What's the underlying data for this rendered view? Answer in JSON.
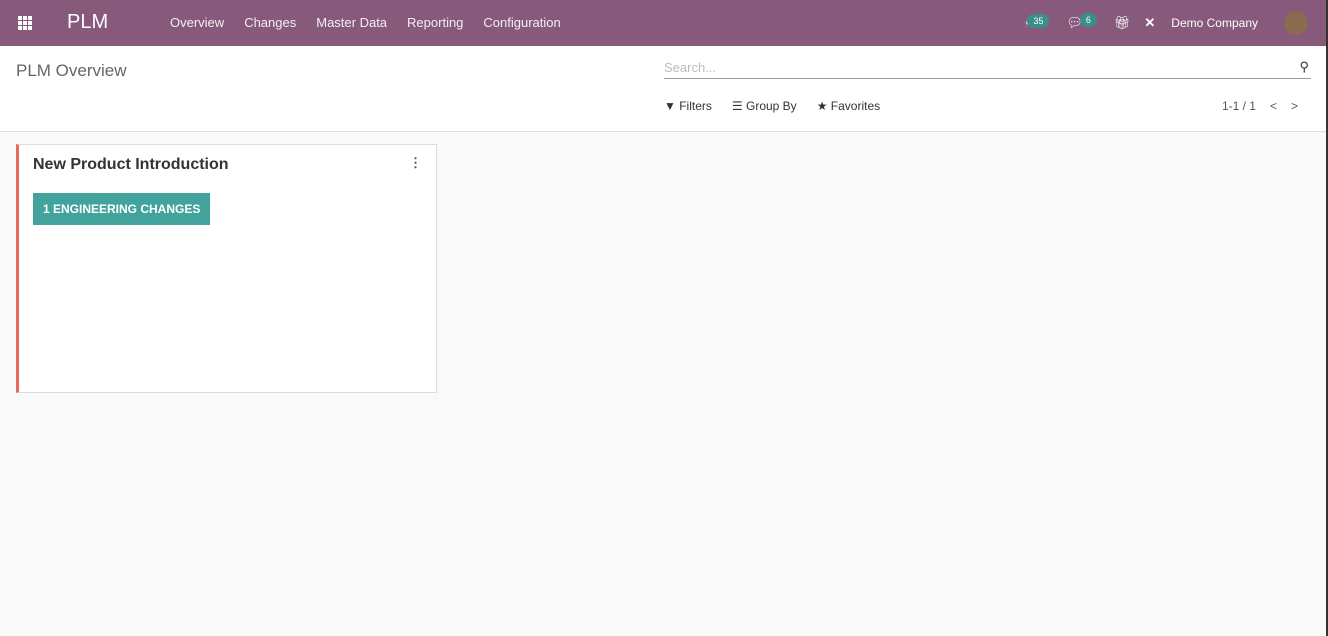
{
  "nav": {
    "brand": "PLM",
    "menu": [
      "Overview",
      "Changes",
      "Master Data",
      "Reporting",
      "Configuration"
    ],
    "activities_count": "35",
    "messages_count": "6",
    "company": "Demo Company"
  },
  "control": {
    "title": "PLM Overview",
    "search_placeholder": "Search...",
    "filters": "Filters",
    "group_by": "Group By",
    "favorites": "Favorites",
    "pager": "1-1 / 1"
  },
  "cards": [
    {
      "title": "New Product Introduction",
      "button": "1 ENGINEERING CHANGES",
      "color": "#e86a5a"
    }
  ]
}
